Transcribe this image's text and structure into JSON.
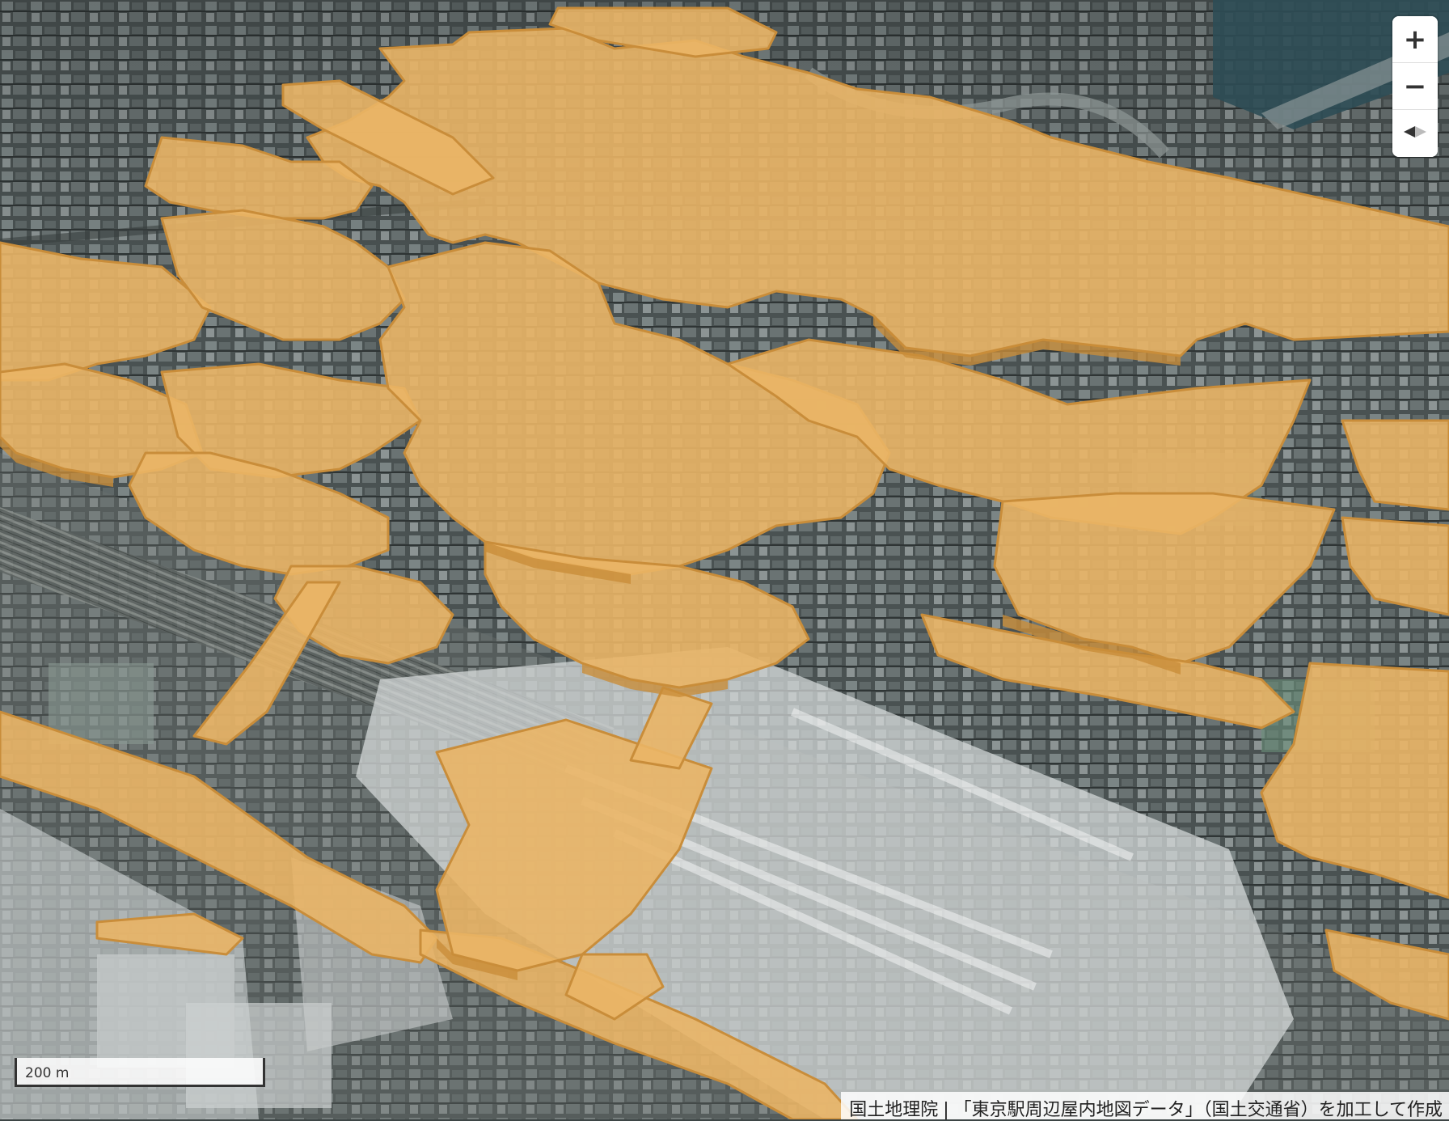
{
  "map": {
    "basemap": "aerial-photo",
    "overlay_color": "#eab566",
    "overlay_edge_color": "#c98d3a",
    "station_area_color": "#cfd3d3"
  },
  "controls": {
    "zoom_in_label": "+",
    "zoom_out_label": "−",
    "compass_icon": "compass-icon"
  },
  "scale": {
    "label": "200 m"
  },
  "attribution": {
    "gsi": "国土地理院",
    "separator": "|",
    "text": "「東京駅周辺屋内地図データ」（国土交通省）を加工して作成"
  }
}
